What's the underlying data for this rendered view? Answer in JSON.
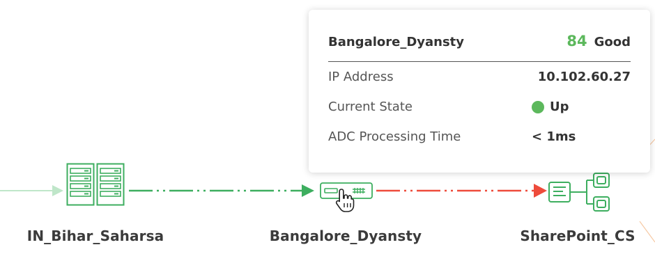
{
  "nodes": {
    "left": {
      "label": "IN_Bihar_Saharsa",
      "icon": "server-rack-icon"
    },
    "center": {
      "label": "Bangalore_Dyansty",
      "icon": "adc-appliance-icon"
    },
    "right": {
      "label": "SharePoint_CS",
      "icon": "service-topology-icon"
    }
  },
  "tooltip": {
    "title": "Bangalore_Dyansty",
    "score": "84",
    "health": "Good",
    "rows": [
      {
        "key": "IP Address",
        "value": "10.102.60.27"
      },
      {
        "key": "Current State",
        "value": "Up"
      },
      {
        "key": "ADC Processing Time",
        "value": "< 1ms"
      }
    ]
  },
  "colors": {
    "healthy_green": "#5cb85c",
    "link_green": "#3dae5f",
    "link_red": "#ee4b3b",
    "faint_orange": "#f6c9a4"
  }
}
